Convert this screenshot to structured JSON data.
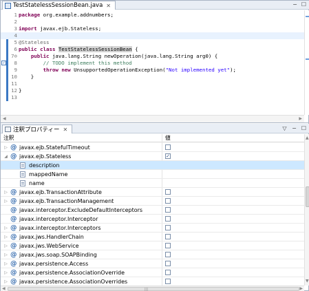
{
  "editor": {
    "tab_label": "TestStatelessSessionBean.java",
    "tab_close": "✕",
    "window_controls": [
      "−",
      "☐"
    ],
    "lines": [
      {
        "n": "1",
        "parts": [
          {
            "t": "package",
            "c": "kw"
          },
          {
            "t": " org.example.addnumbers;",
            "c": ""
          }
        ]
      },
      {
        "n": "2",
        "parts": []
      },
      {
        "n": "3",
        "parts": [
          {
            "t": "import",
            "c": "kw"
          },
          {
            "t": " javax.ejb.Stateless;",
            "c": ""
          }
        ]
      },
      {
        "n": "4",
        "parts": []
      },
      {
        "n": "5",
        "parts": [
          {
            "t": "@Stateless",
            "c": "ann"
          }
        ]
      },
      {
        "n": "6",
        "parts": [
          {
            "t": "public",
            "c": "kw"
          },
          {
            "t": " ",
            "c": ""
          },
          {
            "t": "class",
            "c": "kw"
          },
          {
            "t": " ",
            "c": ""
          },
          {
            "t": "TestStatelessSessionBean",
            "c": "sel"
          },
          {
            "t": " {",
            "c": ""
          }
        ]
      },
      {
        "n": "7⊖",
        "parts": [
          {
            "t": "    ",
            "c": ""
          },
          {
            "t": "public",
            "c": "kw"
          },
          {
            "t": " java.lang.String newOperation(java.lang.String arg0) {",
            "c": ""
          }
        ]
      },
      {
        "n": "8",
        "parts": [
          {
            "t": "        // TODO implement this method",
            "c": "cmt"
          }
        ]
      },
      {
        "n": "9",
        "parts": [
          {
            "t": "        ",
            "c": ""
          },
          {
            "t": "throw",
            "c": "kw"
          },
          {
            "t": " ",
            "c": ""
          },
          {
            "t": "new",
            "c": "kw"
          },
          {
            "t": " UnsupportedOperationException(",
            "c": ""
          },
          {
            "t": "\"Not implemented yet\"",
            "c": "str"
          },
          {
            "t": ");",
            "c": ""
          }
        ]
      },
      {
        "n": "10",
        "parts": [
          {
            "t": "    }",
            "c": ""
          }
        ]
      },
      {
        "n": "11",
        "parts": []
      },
      {
        "n": "12",
        "parts": [
          {
            "t": "}",
            "c": ""
          }
        ]
      },
      {
        "n": "13",
        "parts": []
      }
    ],
    "highlighted_line_index": 3,
    "task_marker_line_index": 7,
    "task_marker_glyph": "✓"
  },
  "annotations_view": {
    "tab_label": "注釈プロパティー",
    "tab_close": "✕",
    "window_controls": [
      "▽",
      "−",
      "☐"
    ],
    "columns": [
      "注釈",
      "値"
    ],
    "rows": [
      {
        "label": "javax.ejb.StatefulTimeout",
        "kind": "annotation",
        "expand": "closed",
        "checked": false
      },
      {
        "label": "javax.ejb.Stateless",
        "kind": "annotation",
        "expand": "open",
        "checked": true
      },
      {
        "label": "description",
        "kind": "property",
        "expand": "none",
        "checked": null,
        "selected": true
      },
      {
        "label": "mappedName",
        "kind": "property",
        "expand": "none",
        "checked": null
      },
      {
        "label": "name",
        "kind": "property",
        "expand": "none",
        "checked": null
      },
      {
        "label": "javax.ejb.TransactionAttribute",
        "kind": "annotation",
        "expand": "closed",
        "checked": false
      },
      {
        "label": "javax.ejb.TransactionManagement",
        "kind": "annotation",
        "expand": "closed",
        "checked": false
      },
      {
        "label": "javax.interceptor.ExcludeDefaultInterceptors",
        "kind": "annotation",
        "expand": "none",
        "checked": false
      },
      {
        "label": "javax.interceptor.Interceptor",
        "kind": "annotation",
        "expand": "none",
        "checked": false
      },
      {
        "label": "javax.interceptor.Interceptors",
        "kind": "annotation",
        "expand": "closed",
        "checked": false
      },
      {
        "label": "javax.jws.HandlerChain",
        "kind": "annotation",
        "expand": "closed",
        "checked": false
      },
      {
        "label": "javax.jws.WebService",
        "kind": "annotation",
        "expand": "closed",
        "checked": false
      },
      {
        "label": "javax.jws.soap.SOAPBinding",
        "kind": "annotation",
        "expand": "closed",
        "checked": false
      },
      {
        "label": "javax.persistence.Access",
        "kind": "annotation",
        "expand": "closed",
        "checked": false
      },
      {
        "label": "javax.persistence.AssociationOverride",
        "kind": "annotation",
        "expand": "closed",
        "checked": false
      },
      {
        "label": "javax.persistence.AssociationOverrides",
        "kind": "annotation",
        "expand": "closed",
        "checked": false
      }
    ]
  }
}
